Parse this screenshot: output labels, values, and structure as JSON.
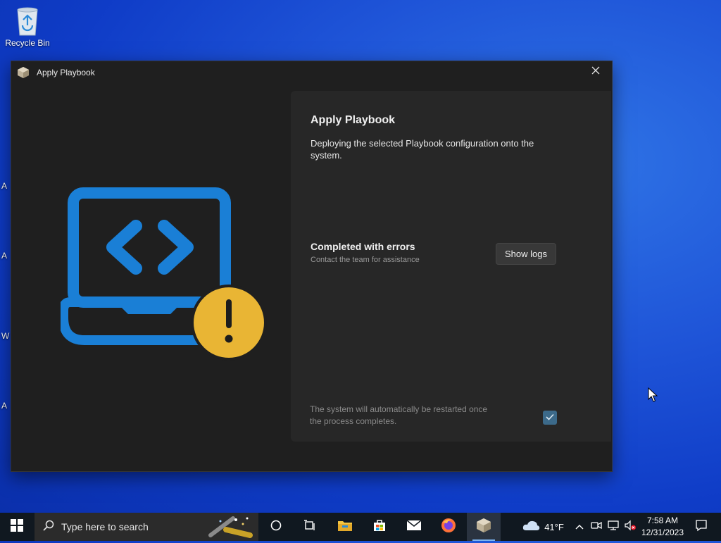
{
  "desktop": {
    "recycle_bin_label": "Recycle Bin",
    "edge_labels": [
      "A",
      "A",
      "W",
      "A"
    ]
  },
  "window": {
    "title": "Apply Playbook",
    "close_icon": "close-icon"
  },
  "panel": {
    "heading": "Apply Playbook",
    "description": "Deploying the selected Playbook configuration onto the system.",
    "status_title": "Completed with errors",
    "status_subtitle": "Contact the team for assistance",
    "show_logs_label": "Show logs",
    "restart_note": "The system will automatically be restarted once the process completes.",
    "restart_checked": true
  },
  "taskbar": {
    "search_placeholder": "Type here to search",
    "pinned": [
      "start-icon",
      "search-icon",
      "cortana-icon",
      "task-view-icon",
      "file-explorer-icon",
      "microsoft-store-icon",
      "mail-icon",
      "firefox-icon",
      "playbook-app-icon"
    ],
    "weather_temp": "41°F",
    "clock_time": "7:58 AM",
    "clock_date": "12/31/2023"
  },
  "colors": {
    "accent_blue": "#1a7fd6",
    "warning_gold": "#e9b534",
    "window_bg": "#1f1f1f",
    "panel_bg": "#272727"
  }
}
